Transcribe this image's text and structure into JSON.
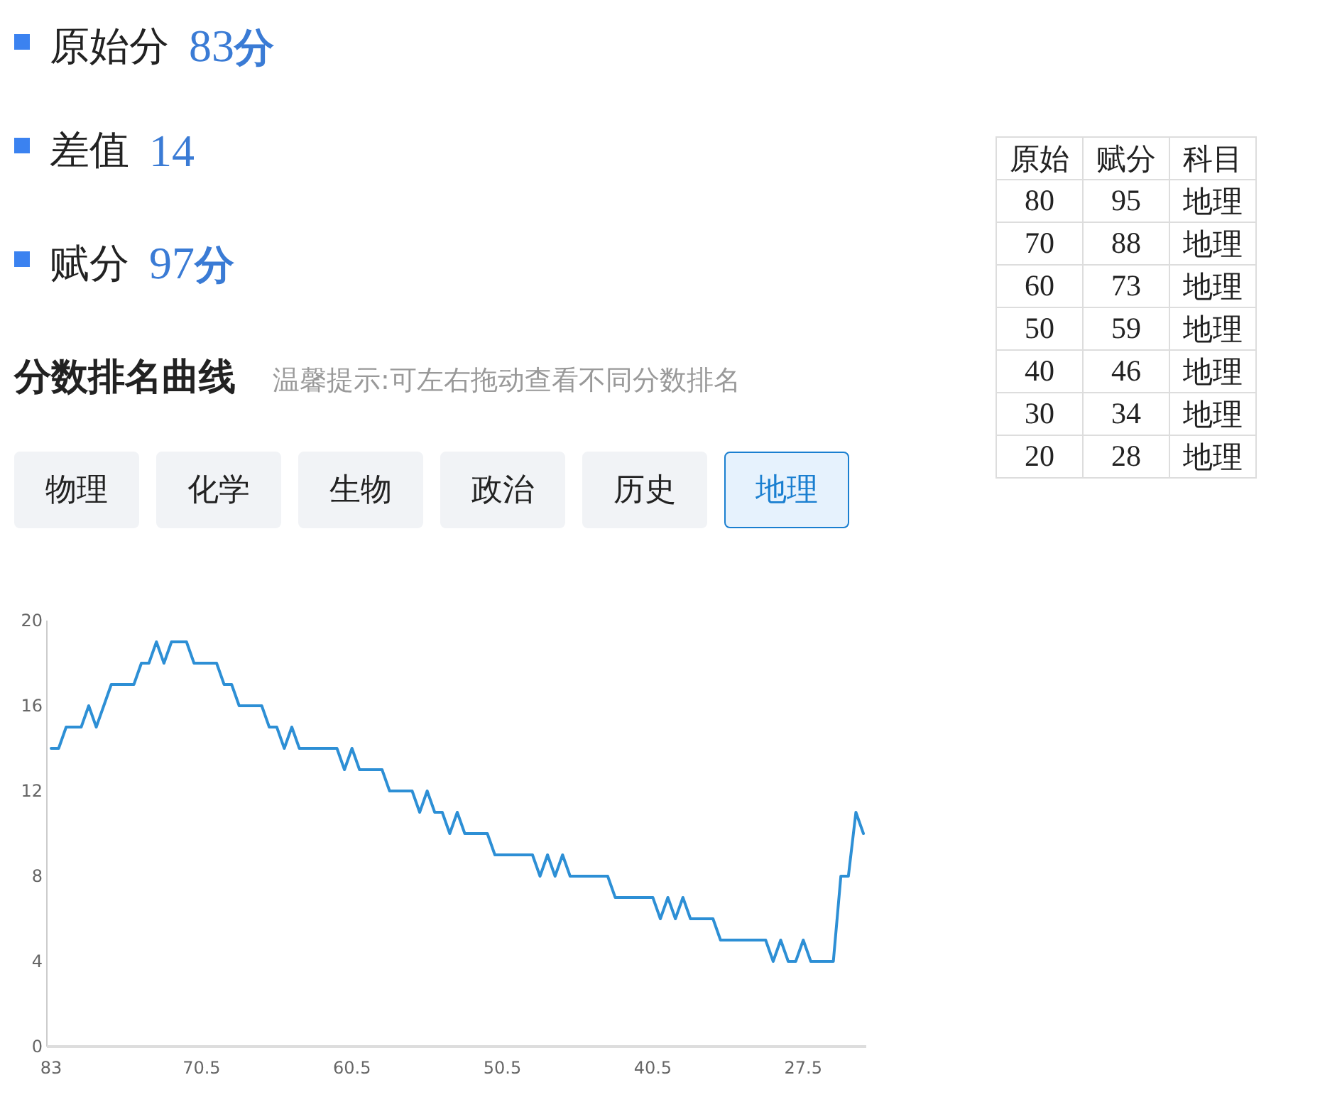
{
  "scores": [
    {
      "label": "原始分",
      "value": "83**分**"
    },
    {
      "label": "差值",
      "value": "14"
    },
    {
      "label": "赋分",
      "value": "97**分**"
    }
  ],
  "section": {
    "title": "分数排名曲线",
    "hint": "温馨提示:可左右拖动查看不同分数排名"
  },
  "tabs": [
    {
      "label": "物理",
      "selected": false
    },
    {
      "label": "化学",
      "selected": false
    },
    {
      "label": "生物",
      "selected": false
    },
    {
      "label": "政治",
      "selected": false
    },
    {
      "label": "历史",
      "selected": false
    },
    {
      "label": "地理",
      "selected": true
    }
  ],
  "table": {
    "columns": [
      "原始",
      "赋分",
      "科目"
    ],
    "rows": [
      [
        "80",
        "95",
        "地理"
      ],
      [
        "70",
        "88",
        "地理"
      ],
      [
        "60",
        "73",
        "地理"
      ],
      [
        "50",
        "59",
        "地理"
      ],
      [
        "40",
        "46",
        "地理"
      ],
      [
        "30",
        "34",
        "地理"
      ],
      [
        "20",
        "28",
        "地理"
      ]
    ]
  },
  "chart_data": {
    "type": "line",
    "categories": [
      "83",
      null,
      null,
      null,
      null,
      null,
      null,
      null,
      null,
      null,
      null,
      null,
      null,
      null,
      null,
      null,
      null,
      null,
      null,
      null,
      "70.5",
      null,
      null,
      null,
      null,
      null,
      null,
      null,
      null,
      null,
      null,
      null,
      null,
      null,
      null,
      null,
      null,
      null,
      null,
      null,
      "60.5",
      null,
      null,
      null,
      null,
      null,
      null,
      null,
      null,
      null,
      null,
      null,
      null,
      null,
      null,
      null,
      null,
      null,
      null,
      null,
      "50.5",
      null,
      null,
      null,
      null,
      null,
      null,
      null,
      null,
      null,
      null,
      null,
      null,
      null,
      null,
      null,
      null,
      null,
      null,
      null,
      "40.5",
      null,
      null,
      null,
      null,
      null,
      null,
      null,
      null,
      null,
      null,
      null,
      null,
      null,
      null,
      null,
      null,
      null,
      null,
      null,
      "27.5",
      null,
      null,
      null,
      null,
      null,
      null,
      null,
      null
    ],
    "series": [
      {
        "color": "#2d8fd5",
        "values": [
          14,
          14,
          15,
          15,
          15,
          16,
          15,
          16,
          17,
          17,
          17,
          17,
          18,
          18,
          19,
          18,
          19,
          19,
          19,
          18,
          18,
          18,
          18,
          17,
          17,
          16,
          16,
          16,
          16,
          15,
          15,
          14,
          15,
          14,
          14,
          14,
          14,
          14,
          14,
          13,
          14,
          13,
          13,
          13,
          13,
          12,
          12,
          12,
          12,
          11,
          12,
          11,
          11,
          10,
          11,
          10,
          10,
          10,
          10,
          9,
          9,
          9,
          9,
          9,
          9,
          8,
          9,
          8,
          9,
          8,
          8,
          8,
          8,
          8,
          8,
          7,
          7,
          7,
          7,
          7,
          7,
          6,
          7,
          6,
          7,
          6,
          6,
          6,
          6,
          5,
          5,
          5,
          5,
          5,
          5,
          5,
          4,
          5,
          4,
          4,
          5,
          4,
          4,
          4,
          4,
          8,
          8,
          11,
          10
        ]
      }
    ],
    "ylim": [
      0,
      20
    ],
    "yticks": [
      0,
      4,
      8,
      12,
      16,
      20
    ]
  }
}
